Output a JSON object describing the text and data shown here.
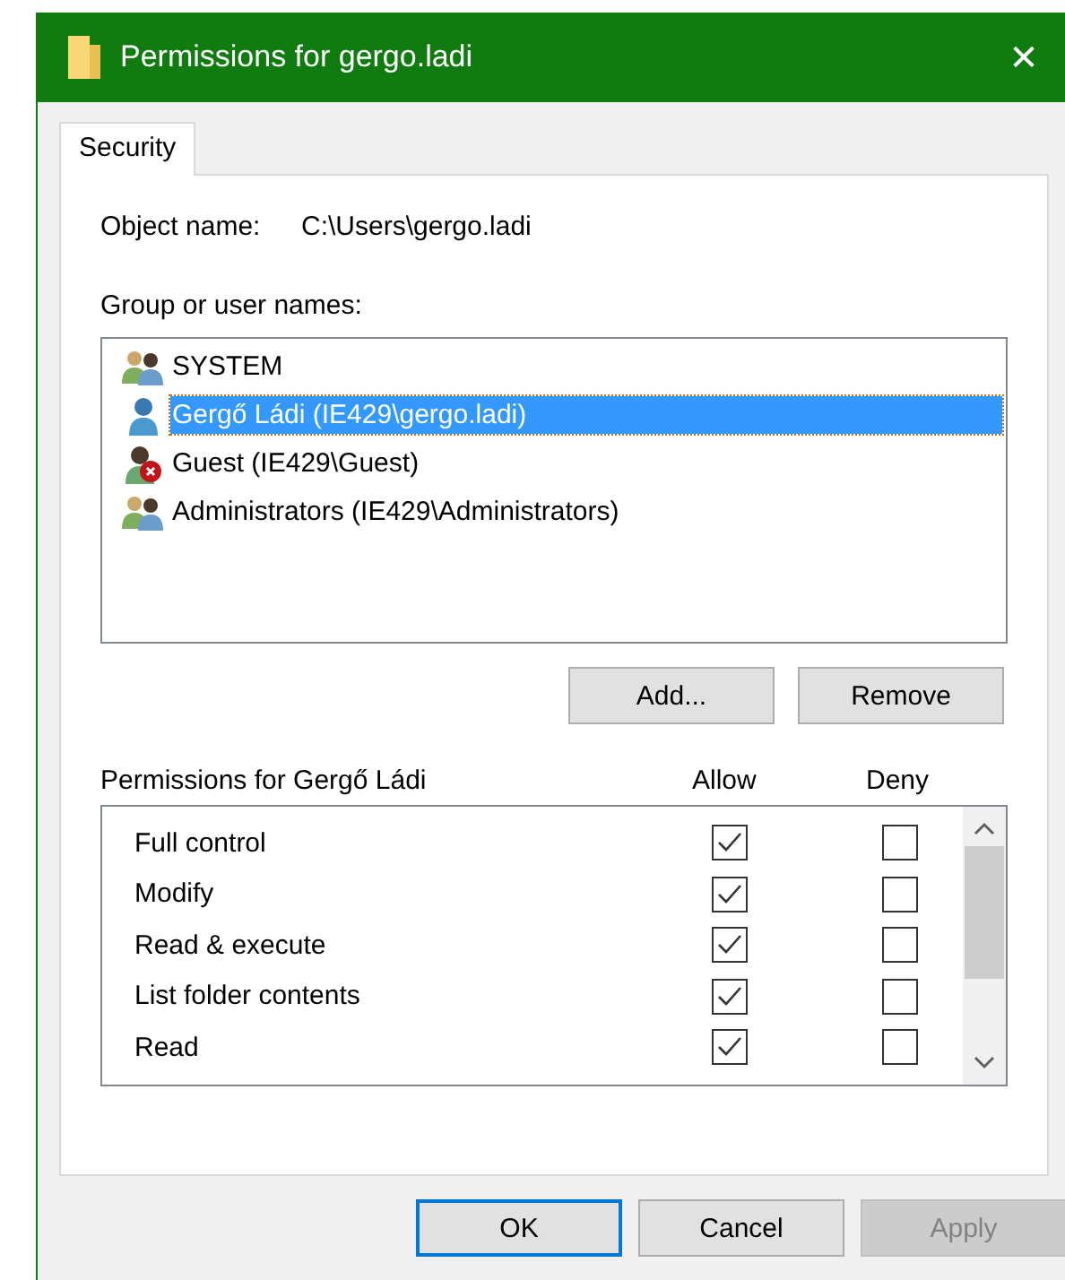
{
  "window": {
    "title": "Permissions for gergo.ladi",
    "close": "✕"
  },
  "tabs": [
    {
      "label": "Security",
      "selected": true
    }
  ],
  "object_name": {
    "label": "Object name:",
    "value": "C:\\Users\\gergo.ladi"
  },
  "users": {
    "label": "Group or user names:",
    "items": [
      {
        "name": "SYSTEM",
        "kind": "group",
        "selected": false
      },
      {
        "name": "Gergő Ládi (IE429\\gergo.ladi)",
        "kind": "user",
        "selected": true
      },
      {
        "name": "Guest (IE429\\Guest)",
        "kind": "disabled-user",
        "selected": false
      },
      {
        "name": "Administrators (IE429\\Administrators)",
        "kind": "group",
        "selected": false
      }
    ]
  },
  "user_buttons": [
    {
      "label": "Add..."
    },
    {
      "label": "Remove"
    }
  ],
  "permissions": {
    "label": "Permissions for Gergő Ládi",
    "allow_header": "Allow",
    "deny_header": "Deny",
    "rows": [
      {
        "name": "Full control",
        "allow": true,
        "deny": false
      },
      {
        "name": "Modify",
        "allow": true,
        "deny": false
      },
      {
        "name": "Read & execute",
        "allow": true,
        "deny": false
      },
      {
        "name": "List folder contents",
        "allow": true,
        "deny": false
      },
      {
        "name": "Read",
        "allow": true,
        "deny": false
      }
    ]
  },
  "buttons": [
    {
      "label": "OK",
      "default": true,
      "disabled": false
    },
    {
      "label": "Cancel",
      "default": false,
      "disabled": false
    },
    {
      "label": "Apply",
      "default": false,
      "disabled": true
    }
  ]
}
